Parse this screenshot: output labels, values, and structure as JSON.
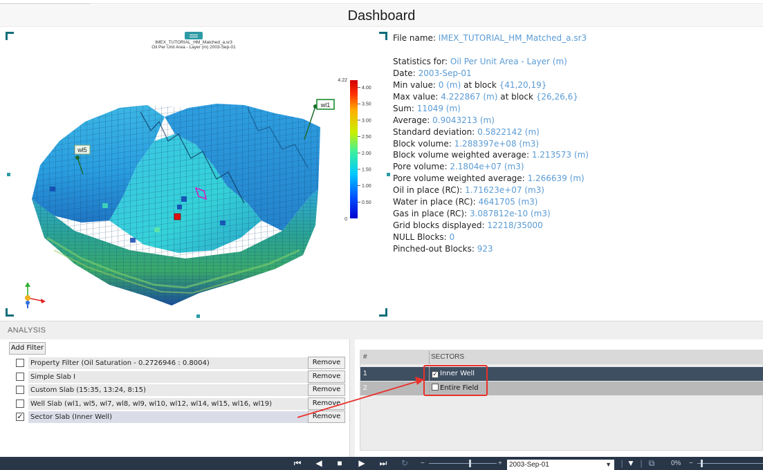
{
  "title": "Dashboard",
  "viewer": {
    "title_line1": "IMEX_TUTORIAL_HM_Matched_a.sr3",
    "title_line2": "Oil Per Unit Area - Layer (m)  2003-Sep-01",
    "colorbar": {
      "max_label": "4.22",
      "min_label": "0",
      "ticks": [
        "4.00",
        "3.50",
        "3.00",
        "2.50",
        "2.00",
        "1.50",
        "1.00",
        "0.50"
      ],
      "tick_values": [
        4.0,
        3.5,
        3.0,
        2.5,
        2.0,
        1.5,
        1.0,
        0.5
      ],
      "max_value": 4.222867
    },
    "wells": [
      "wl1",
      "wl5"
    ]
  },
  "stats": {
    "file_label": "File name:",
    "file_value": "IMEX_TUTORIAL_HM_Matched_a.sr3",
    "stats_for_label": "Statistics for:",
    "stats_for_value": "Oil Per Unit Area - Layer (m)",
    "date_label": "Date:",
    "date_value": "2003-Sep-01",
    "min_label": "Min value:",
    "min_value": "0 (m)",
    "min_at": "at block",
    "min_block": "{41,20,19}",
    "max_label": "Max value:",
    "max_value": "4.222867 (m)",
    "max_at": "at block",
    "max_block": "{26,26,6}",
    "sum_label": "Sum:",
    "sum_value": "11049 (m)",
    "avg_label": "Average:",
    "avg_value": "0.9043213 (m)",
    "std_label": "Standard deviation:",
    "std_value": "0.5822142 (m)",
    "bvol_label": "Block volume:",
    "bvol_value": "1.288397e+08 (m3)",
    "bvwa_label": "Block volume weighted average:",
    "bvwa_value": "1.213573 (m)",
    "pvol_label": "Pore volume:",
    "pvol_value": "2.1804e+07 (m3)",
    "pvwa_label": "Pore volume weighted average:",
    "pvwa_value": "1.266639 (m)",
    "oip_label": "Oil in place (RC):",
    "oip_value": "1.71623e+07 (m3)",
    "wip_label": "Water in place (RC):",
    "wip_value": "4641705 (m3)",
    "gip_label": "Gas in place (RC):",
    "gip_value": "3.087812e-10 (m3)",
    "gbd_label": "Grid blocks displayed:",
    "gbd_value": "12218/35000",
    "null_label": "NULL Blocks:",
    "null_value": "0",
    "pinch_label": "Pinched-out Blocks:",
    "pinch_value": "923"
  },
  "analysis": {
    "header": "ANALYSIS",
    "add_filter": "Add Filter",
    "remove_label": "Remove",
    "filters": [
      {
        "label": "Property Filter (Oil Saturation - 0.2726946 : 0.8004)",
        "checked": false
      },
      {
        "label": "Simple Slab I",
        "checked": false
      },
      {
        "label": "Custom Slab (15:35, 13:24, 8:15)",
        "checked": false
      },
      {
        "label": "Well Slab (wl1, wl5, wl7, wl8, wl9, wl10, wl12, wl14, wl15, wl16, wl19)",
        "checked": false
      },
      {
        "label": "Sector Slab (Inner Well)",
        "checked": true
      }
    ]
  },
  "sectors": {
    "col_num": "#",
    "col_name": "SECTORS",
    "rows": [
      {
        "num": "1",
        "name": "Inner Well",
        "checked": true
      },
      {
        "num": "2",
        "name": "Entire  Field",
        "checked": false
      }
    ]
  },
  "toolbar": {
    "minus": "−",
    "plus": "+",
    "date": "2003-Sep-01",
    "zoom": "0%",
    "dash": "−"
  },
  "colors": {
    "accent_teal": "#0f6d7a",
    "value_blue": "#5a9bd4",
    "toolbar_bg": "#283648",
    "annotation_red": "#e8302a",
    "selected_row": "#3e4f62"
  }
}
